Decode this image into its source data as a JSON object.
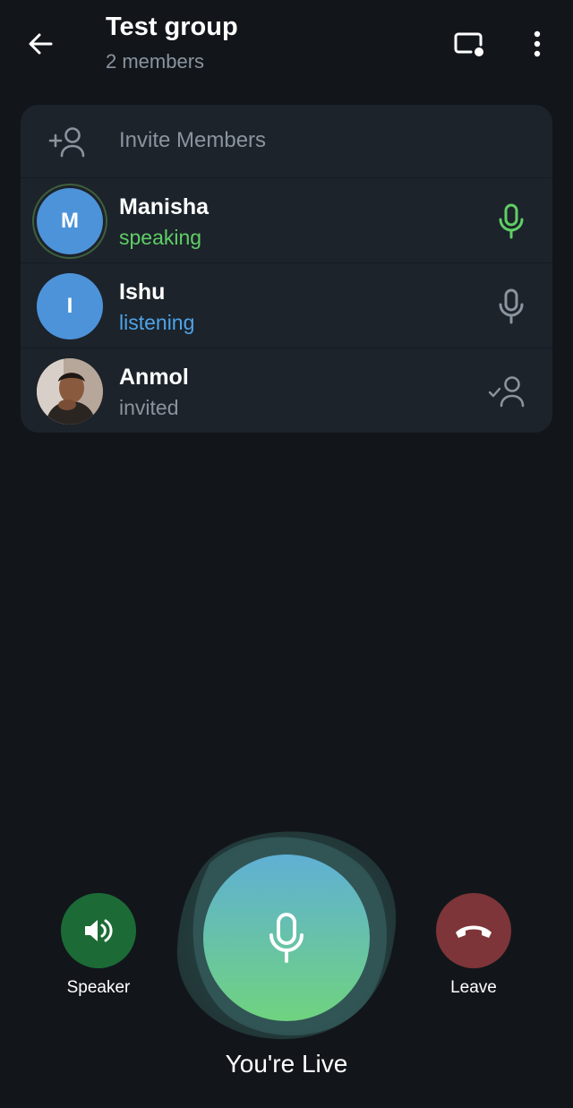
{
  "header": {
    "title": "Test group",
    "subtitle": "2 members"
  },
  "invite": {
    "label": "Invite Members"
  },
  "participants": [
    {
      "name": "Manisha",
      "initial": "M",
      "status": "speaking",
      "status_color": "#5fcf65",
      "icon": "mic-active-icon"
    },
    {
      "name": "Ishu",
      "initial": "I",
      "status": "listening",
      "status_color": "#4ea4e8",
      "icon": "mic-icon"
    },
    {
      "name": "Anmol",
      "status": "invited",
      "status_color": "#8a949e",
      "icon": "invited-user-icon"
    }
  ],
  "controls": {
    "speaker_label": "Speaker",
    "leave_label": "Leave",
    "live_label": "You're Live"
  },
  "colors": {
    "background": "#12161b",
    "panel": "#1c232b",
    "speaker_button": "#1c6b36",
    "leave_button": "#7d3539",
    "mic_gradient_top": "#5fb0d4",
    "mic_gradient_bottom": "#6fd37f"
  }
}
